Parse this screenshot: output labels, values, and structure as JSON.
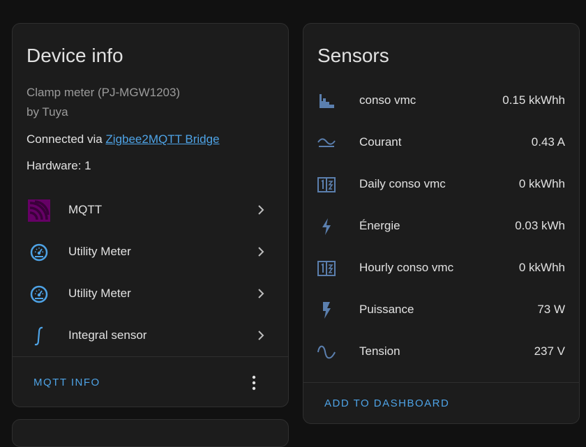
{
  "device_card": {
    "title": "Device info",
    "model": "Clamp meter (PJ-MGW1203)",
    "manufacturer": "by Tuya",
    "connected_prefix": "Connected via ",
    "connected_link": "Zigbee2MQTT Bridge",
    "hardware": "Hardware: 1",
    "integrations": [
      {
        "label": "MQTT",
        "icon": "mqtt-icon"
      },
      {
        "label": "Utility Meter",
        "icon": "gauge-icon"
      },
      {
        "label": "Utility Meter",
        "icon": "gauge-icon"
      },
      {
        "label": "Integral sensor",
        "icon": "integral-icon"
      }
    ],
    "action_button": "MQTT INFO"
  },
  "sensors_card": {
    "title": "Sensors",
    "sensors": [
      {
        "name": "conso vmc",
        "value": "0.15 kkWhh",
        "icon": "chart-histogram-icon"
      },
      {
        "name": "Courant",
        "value": "0.43 A",
        "icon": "current-ac-icon"
      },
      {
        "name": "Daily conso vmc",
        "value": "0 kkWhh",
        "icon": "counter-icon"
      },
      {
        "name": "Énergie",
        "value": "0.03 kWh",
        "icon": "lightning-bolt-icon"
      },
      {
        "name": "Hourly conso vmc",
        "value": "0 kkWhh",
        "icon": "counter-icon"
      },
      {
        "name": "Puissance",
        "value": "73 W",
        "icon": "flash-icon"
      },
      {
        "name": "Tension",
        "value": "237 V",
        "icon": "sine-wave-icon"
      }
    ],
    "action_button": "ADD TO DASHBOARD"
  },
  "colors": {
    "accent": "#4ea3e6",
    "icon_blue": "#4ea3e6",
    "sensor_icon": "#5b7fae",
    "mqtt_purple": "#660066",
    "background": "#111111",
    "card": "#1c1c1c"
  }
}
